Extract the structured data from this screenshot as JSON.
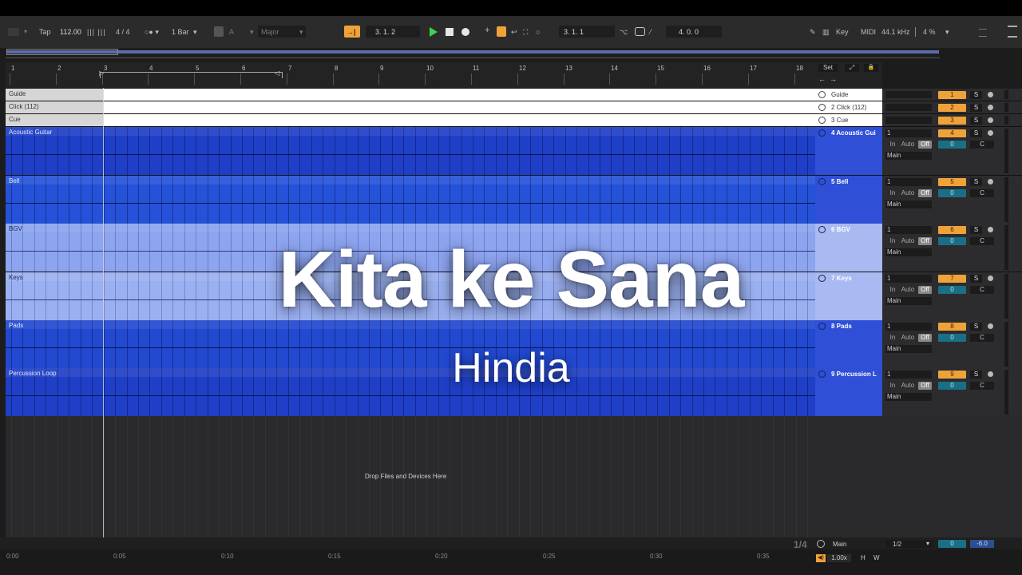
{
  "control_bar": {
    "tap_label": "Tap",
    "tempo": "112.00",
    "time_signature": "4 / 4",
    "quantize": "1 Bar",
    "key_root": "A",
    "scale": "Major",
    "arrangement_position": "3.  1.  2",
    "loop_start": "3.  1.  1",
    "loop_length": "4.  0.  0",
    "key_label": "Key",
    "midi_label": "MIDI",
    "sample_rate": "44.1 kHz",
    "cpu": "4 %",
    "accent_color": "#f0a23a"
  },
  "ruler": {
    "bars": [
      "1",
      "2",
      "3",
      "4",
      "5",
      "6",
      "7",
      "8",
      "9",
      "10",
      "11",
      "12",
      "13",
      "14",
      "15",
      "16",
      "17",
      "18"
    ],
    "set_label": "Set"
  },
  "tracks": [
    {
      "name": "Guide",
      "header": "Guide",
      "number": "1",
      "kind": "return",
      "clip_color": "#ffffff"
    },
    {
      "name": "Click (112)",
      "header": "2 Click (112)",
      "number": "2",
      "kind": "return",
      "clip_color": "#ffffff"
    },
    {
      "name": "Cue",
      "header": "3 Cue",
      "number": "3",
      "kind": "return",
      "clip_color": "#ffffff"
    },
    {
      "name": "Acoustic Guitar",
      "header": "4 Acoustic Gui",
      "number": "4",
      "kind": "audio",
      "clip_color": "#1f3fc7",
      "input": "1",
      "route": "Main",
      "vol": "0",
      "pan": "C"
    },
    {
      "name": "Bell",
      "header": "5 Bell",
      "number": "5",
      "kind": "audio",
      "clip_color": "#2552d8",
      "input": "1",
      "route": "Main",
      "vol": "0",
      "pan": "C"
    },
    {
      "name": "BGV",
      "header": "6 BGV",
      "number": "6",
      "kind": "audio",
      "clip_color": "#8da4ee",
      "input": "1",
      "route": "Main",
      "vol": "0",
      "pan": "C"
    },
    {
      "name": "Keys",
      "header": "7 Keys",
      "number": "7",
      "kind": "audio",
      "clip_color": "#9bb0f0",
      "input": "1",
      "route": "Main",
      "vol": "0",
      "pan": "C"
    },
    {
      "name": "Pads",
      "header": "8 Pads",
      "number": "8",
      "kind": "audio",
      "clip_color": "#2249d0",
      "input": "1",
      "route": "Main",
      "vol": "0",
      "pan": "C"
    },
    {
      "name": "Percussion Loop",
      "header": "9 Percussion L",
      "number": "9",
      "kind": "audio",
      "clip_color": "#1f3fc7",
      "input": "1",
      "route": "Main",
      "vol": "0",
      "pan": "C"
    }
  ],
  "mixer_labels": {
    "solo": "S",
    "in": "In",
    "auto": "Auto",
    "off": "Off"
  },
  "drop_zone_text": "Drop Files and Devices Here",
  "main_track": {
    "page": "1/4",
    "name": "Main",
    "ratio": "1/2",
    "vol": "0",
    "db": "-6.0"
  },
  "bottom": {
    "zoom": "1.00x",
    "h_label": "H",
    "w_label": "W",
    "times": [
      "0:00",
      "0:05",
      "0:10",
      "0:15",
      "0:20",
      "0:25",
      "0:30",
      "0:35"
    ]
  },
  "overlay": {
    "title": "Kita ke Sana",
    "artist": "Hindia"
  }
}
